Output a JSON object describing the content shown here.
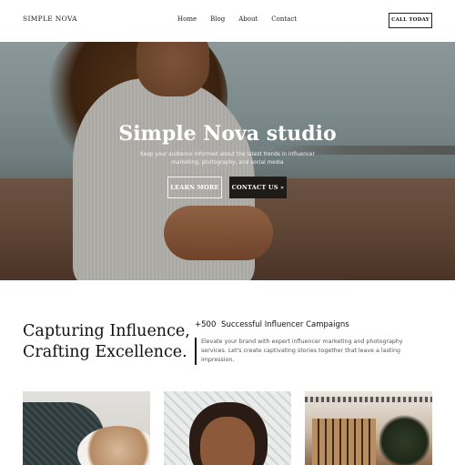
{
  "header": {
    "brand": "SIMPLE NOVA",
    "nav": [
      "Home",
      "Blog",
      "About",
      "Contact"
    ],
    "cta": "CALL TODAY"
  },
  "hero": {
    "title": "Simple Nova studio",
    "subtitle": "Keep your audience informed about the latest trends in influencer marketing, photography, and social media",
    "learn_more": "LEARN MORE",
    "contact_us": "CONTACT US »"
  },
  "info": {
    "headline_line1": "Capturing Influence,",
    "headline_line2": "Crafting Excellence.",
    "stat_number": "+500",
    "stat_label": "Successful Influencer Campaigns",
    "description": "Elevate your brand with expert influencer marketing and photography services. Let's create captivating stories together that leave a lasting impression."
  },
  "colors": {
    "accent_dark": "#1e1b19",
    "text": "#1a1a1a"
  }
}
